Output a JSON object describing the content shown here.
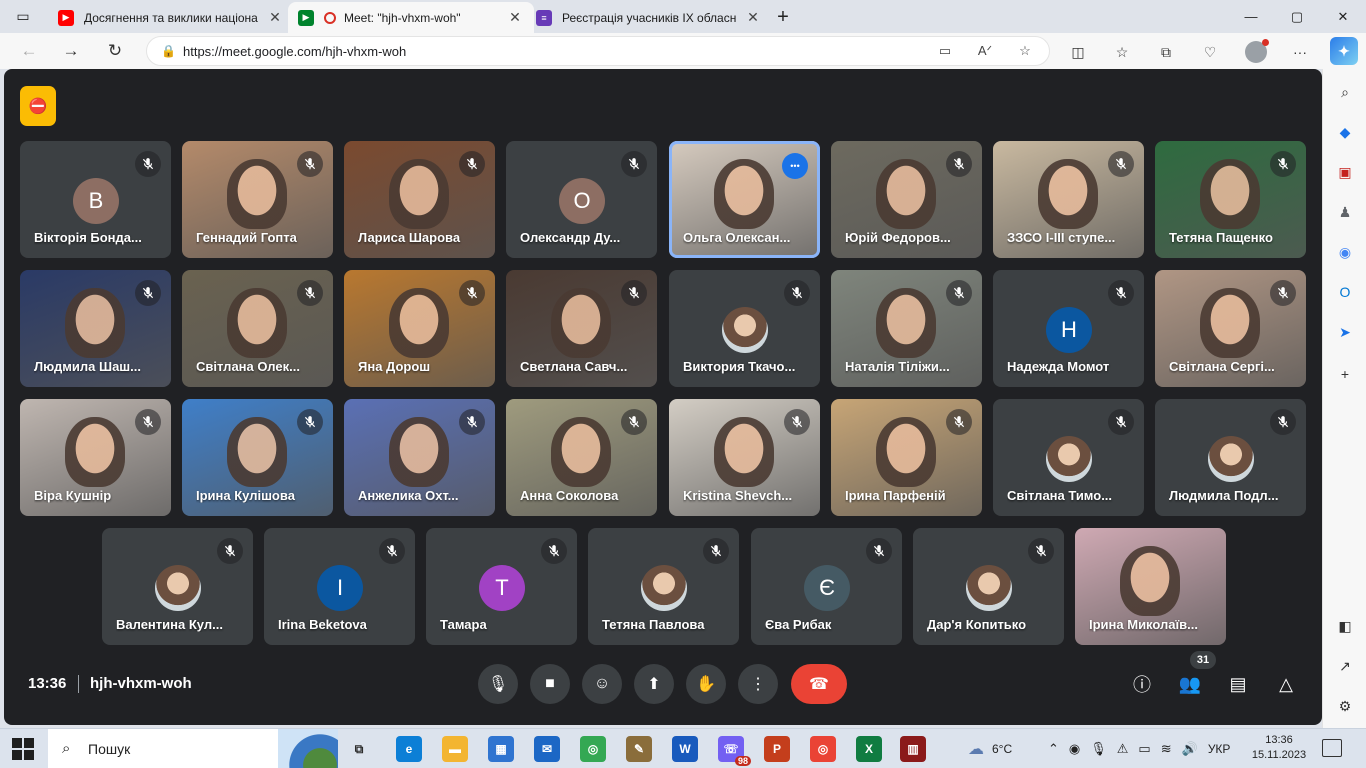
{
  "browser": {
    "tabs": [
      {
        "title": "Досягнення та виклики націона",
        "favicon_color": "#ff0000",
        "active": false
      },
      {
        "title": "Meet: \"hjh-vhxm-woh\"",
        "favicon_color": "#00832d",
        "active": true
      },
      {
        "title": "Реєстрація учасників IX обласн",
        "favicon_color": "#673ab7",
        "active": false
      }
    ],
    "url": "https://meet.google.com/hjh-vhxm-woh",
    "icons": {
      "back": "←",
      "forward": "→",
      "reload": "↻",
      "lock": "🔒",
      "camera": "▭",
      "read_aloud": "Aᐟ",
      "favorite": "☆",
      "split": "◫",
      "favorites": "☆",
      "collections": "⧉",
      "security": "♡",
      "more": "···",
      "new_tab": "+",
      "close": "✕",
      "minimize": "—",
      "maximize": "▢",
      "window_close": "✕"
    }
  },
  "meet": {
    "recording_icon": "⛔",
    "participants": [
      {
        "name": "Вікторія Бонда...",
        "kind": "avatar",
        "letter": "В",
        "color": "#8d6e63"
      },
      {
        "name": "Геннадий Гопта",
        "kind": "video",
        "color": "#b48a6a"
      },
      {
        "name": "Лариса Шарова",
        "kind": "video",
        "color": "#7b4a2f"
      },
      {
        "name": "Олександр Ду...",
        "kind": "avatar",
        "letter": "О",
        "color": "#8d6e63"
      },
      {
        "name": "Ольга Олексан...",
        "kind": "video",
        "color": "#d6cbbf",
        "talking": true
      },
      {
        "name": "Юрій Федоров...",
        "kind": "video",
        "color": "#6d6a5f"
      },
      {
        "name": "ЗЗСО І-ІІІ ступе...",
        "kind": "video",
        "color": "#c9b9a0"
      },
      {
        "name": "Тетяна Пащенко",
        "kind": "video",
        "color": "#2e6b3f"
      },
      {
        "name": "Людмила Шаш...",
        "kind": "video",
        "color": "#2a3a66"
      },
      {
        "name": "Світлана Олек...",
        "kind": "video",
        "color": "#6a6250"
      },
      {
        "name": "Яна Дорош",
        "kind": "video",
        "color": "#b9782f"
      },
      {
        "name": "Светлана Савч...",
        "kind": "video",
        "color": "#4a3a32"
      },
      {
        "name": "Виктория Ткачо...",
        "kind": "avatar",
        "letter": "",
        "color": "#c8ad93",
        "photo": true
      },
      {
        "name": "Наталія Тіліжи...",
        "kind": "video",
        "color": "#7f857c"
      },
      {
        "name": "Надежда Момот",
        "kind": "avatar",
        "letter": "Н",
        "color": "#0b57a0"
      },
      {
        "name": "Світлана Сергі...",
        "kind": "video",
        "color": "#b09684"
      },
      {
        "name": "Віра Кушнір",
        "kind": "video",
        "color": "#bfb6b0"
      },
      {
        "name": "Ірина Кулішова",
        "kind": "video",
        "color": "#3f7fc9"
      },
      {
        "name": "Анжелика Охт...",
        "kind": "video",
        "color": "#5a70b5"
      },
      {
        "name": "Анна Соколова",
        "kind": "video",
        "color": "#9f9b7e"
      },
      {
        "name": "Kristina Shevch...",
        "kind": "video",
        "color": "#d3cdc4"
      },
      {
        "name": "Ірина Парфеній",
        "kind": "video",
        "color": "#c7a576"
      },
      {
        "name": "Світлана Тимо...",
        "kind": "avatar",
        "letter": "",
        "color": "#dfe8f0",
        "photo": true
      },
      {
        "name": "Людмила Подл...",
        "kind": "avatar",
        "letter": "",
        "color": "#dbe7f5",
        "photo": true
      },
      {
        "name": "Валентина Кул...",
        "kind": "avatar",
        "letter": "",
        "color": "#d9c9be",
        "photo": true
      },
      {
        "name": "Irina Beketova",
        "kind": "avatar",
        "letter": "I",
        "color": "#0b57a0"
      },
      {
        "name": "Тамара",
        "kind": "avatar",
        "letter": "Т",
        "color": "#a142c4"
      },
      {
        "name": "Тетяна Павлова",
        "kind": "avatar",
        "letter": "",
        "color": "#c9a98f",
        "photo": true
      },
      {
        "name": "Єва Рибак",
        "kind": "avatar",
        "letter": "Є",
        "color": "#455a64"
      },
      {
        "name": "Дар'я Копитько",
        "kind": "avatar",
        "letter": "",
        "color": "#f0ddc8",
        "photo": true
      },
      {
        "name": "Ірина Миколаїв...",
        "kind": "video",
        "color": "#cfa9b3"
      }
    ],
    "bottom": {
      "time": "13:36",
      "code": "hjh-vhxm-woh",
      "controls": [
        {
          "name": "mic",
          "glyph": "🎙"
        },
        {
          "name": "camera",
          "glyph": "■"
        },
        {
          "name": "emoji",
          "glyph": "☺"
        },
        {
          "name": "present",
          "glyph": "⬆"
        },
        {
          "name": "raise-hand",
          "glyph": "✋"
        },
        {
          "name": "more-options",
          "glyph": "⋮"
        },
        {
          "name": "leave-call",
          "glyph": "☎"
        }
      ],
      "right": [
        {
          "name": "info",
          "glyph": "ⓘ"
        },
        {
          "name": "people",
          "glyph": "👥"
        },
        {
          "name": "chat",
          "glyph": "▤"
        },
        {
          "name": "activities",
          "glyph": "△"
        }
      ],
      "people_count": "31"
    }
  },
  "edge_sidebar": [
    {
      "name": "search",
      "glyph": "⌕",
      "color": "#333"
    },
    {
      "name": "shopping",
      "glyph": "◆",
      "color": "#1a73e8"
    },
    {
      "name": "tools",
      "glyph": "▣",
      "color": "#c5221f"
    },
    {
      "name": "games",
      "glyph": "♟",
      "color": "#5f6368"
    },
    {
      "name": "copilot",
      "glyph": "◉",
      "color": "#4285f4"
    },
    {
      "name": "outlook",
      "glyph": "O",
      "color": "#0078d4"
    },
    {
      "name": "send",
      "glyph": "➤",
      "color": "#1a73e8"
    },
    {
      "name": "add",
      "glyph": "+",
      "color": "#333"
    },
    {
      "name": "sidebar-toggle",
      "glyph": "◧",
      "color": "#333"
    },
    {
      "name": "external",
      "glyph": "↗",
      "color": "#333"
    },
    {
      "name": "settings",
      "glyph": "⚙",
      "color": "#333"
    }
  ],
  "taskbar": {
    "search_label": "Пошук",
    "apps": [
      {
        "name": "task-view",
        "glyph": "⧉",
        "color": "#2b2b2b",
        "badge": ""
      },
      {
        "name": "edge",
        "glyph": "e",
        "color": "#0c7fd6",
        "badge": ""
      },
      {
        "name": "explorer",
        "glyph": "▬",
        "color": "#f3b531",
        "badge": ""
      },
      {
        "name": "store",
        "glyph": "▦",
        "color": "#2f74d0",
        "badge": ""
      },
      {
        "name": "mail",
        "glyph": "✉",
        "color": "#1c67c5",
        "badge": ""
      },
      {
        "name": "chrome",
        "glyph": "◎",
        "color": "#34a853",
        "badge": ""
      },
      {
        "name": "paint",
        "glyph": "✎",
        "color": "#8a6d3b",
        "badge": ""
      },
      {
        "name": "word",
        "glyph": "W",
        "color": "#185abd",
        "badge": ""
      },
      {
        "name": "viber",
        "glyph": "☏",
        "color": "#7360f2",
        "badge": "98"
      },
      {
        "name": "powerpoint",
        "glyph": "P",
        "color": "#c43e1c",
        "badge": ""
      },
      {
        "name": "chrome-2",
        "glyph": "◎",
        "color": "#ea4335",
        "badge": ""
      },
      {
        "name": "excel",
        "glyph": "X",
        "color": "#107c41",
        "badge": ""
      },
      {
        "name": "winrar",
        "glyph": "▥",
        "color": "#8b1a1a",
        "badge": ""
      }
    ],
    "weather": "6°C",
    "language": "УКР",
    "time": "13:36",
    "date": "15.11.2023"
  }
}
